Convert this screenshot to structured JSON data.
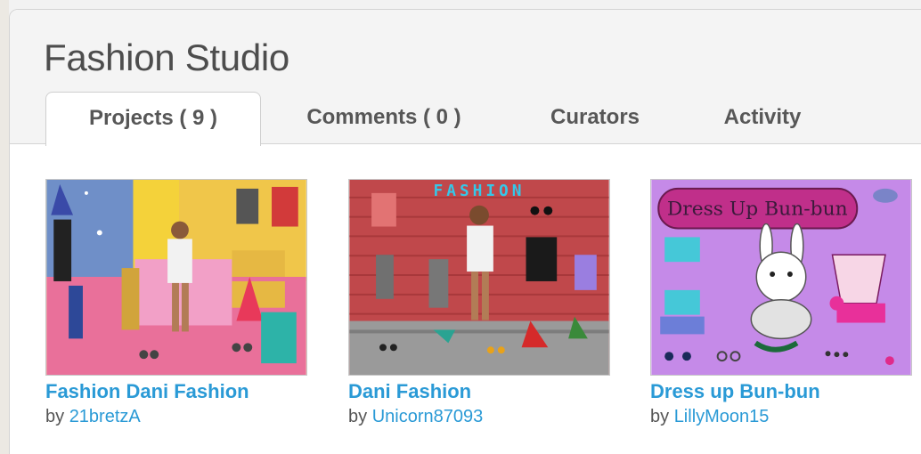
{
  "studio": {
    "title": "Fashion Studio"
  },
  "tabs": [
    {
      "label": "Projects ( 9 )",
      "active": true
    },
    {
      "label": "Comments ( 0 )",
      "active": false
    },
    {
      "label": "Curators",
      "active": false
    },
    {
      "label": "Activity",
      "active": false
    }
  ],
  "projects": [
    {
      "title": "Fashion Dani Fashion",
      "by": "by",
      "author": "21bretzA"
    },
    {
      "title": "Dani Fashion",
      "by": "by",
      "author": "Unicorn87093",
      "thumb_text": "FASHION"
    },
    {
      "title": "Dress up Bun-bun",
      "by": "by",
      "author": "LillyMoon15",
      "thumb_text": "Dress Up Bun-bun"
    }
  ],
  "colors": {
    "link": "#2a9ad6",
    "title_text": "#4d4d4d",
    "tab_text": "#575757"
  }
}
